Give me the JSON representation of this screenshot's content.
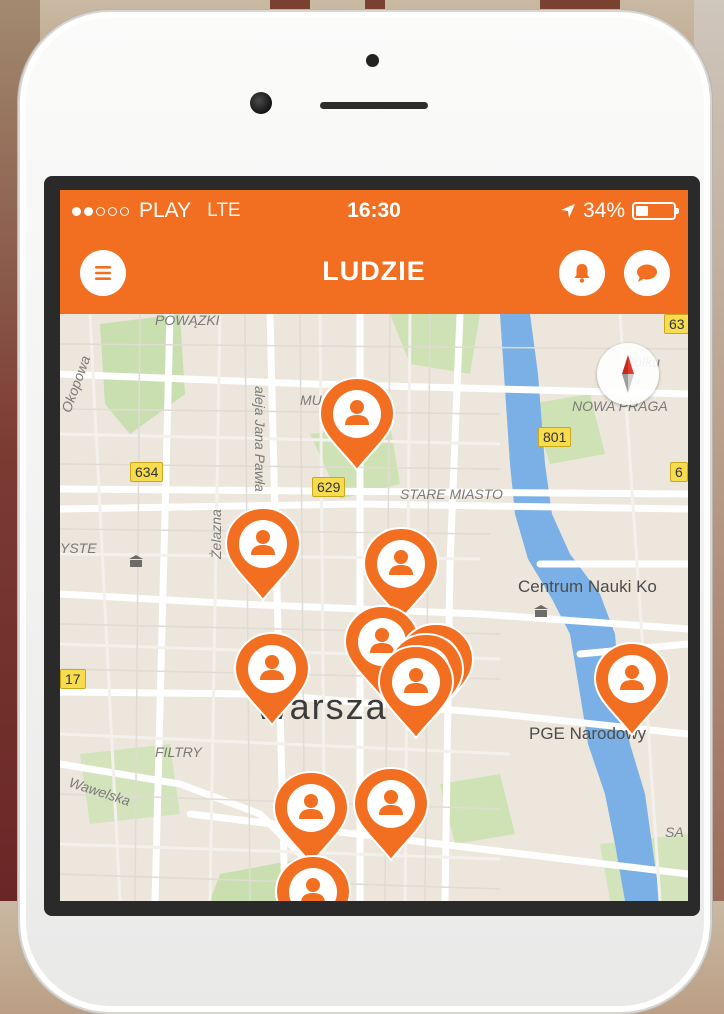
{
  "status_bar": {
    "carrier": "PLAY",
    "network": "LTE",
    "time": "16:30",
    "battery_percent": "34%",
    "battery_level": 0.34,
    "signal_bars_filled": 2,
    "signal_bars_total": 5
  },
  "app_bar": {
    "title": "LUDZIE",
    "menu_icon": "menu-icon",
    "bell_icon": "bell-icon",
    "chat_icon": "chat-icon",
    "accent_color": "#f26f21"
  },
  "map": {
    "labels": {
      "powazki": "POWĄZKI",
      "pulku": "Pułku",
      "nowa_praga": "NOWA PRAGA",
      "stare_miasto": "STARE MIASTO",
      "centrum_nauki": "Centrum Nauki Ko",
      "pge": "PGE Narodowy",
      "filtry": "FILTRY",
      "wawelska": "Wawelska",
      "zelazna": "Żelazna",
      "aleja": "aleja Jana Pawła",
      "warszawa": "Warsza",
      "muranow": "MU",
      "ryste": "YSTE",
      "okopowa": "Okopowa",
      "sa": "SA"
    },
    "road_badges": {
      "r634": "634",
      "r629": "629",
      "r801": "801",
      "r63": "63",
      "r6": "6",
      "r17": "17"
    },
    "compass_icon": "compass-icon",
    "pin_icon": "person-pin-icon",
    "pin_count": 13
  }
}
